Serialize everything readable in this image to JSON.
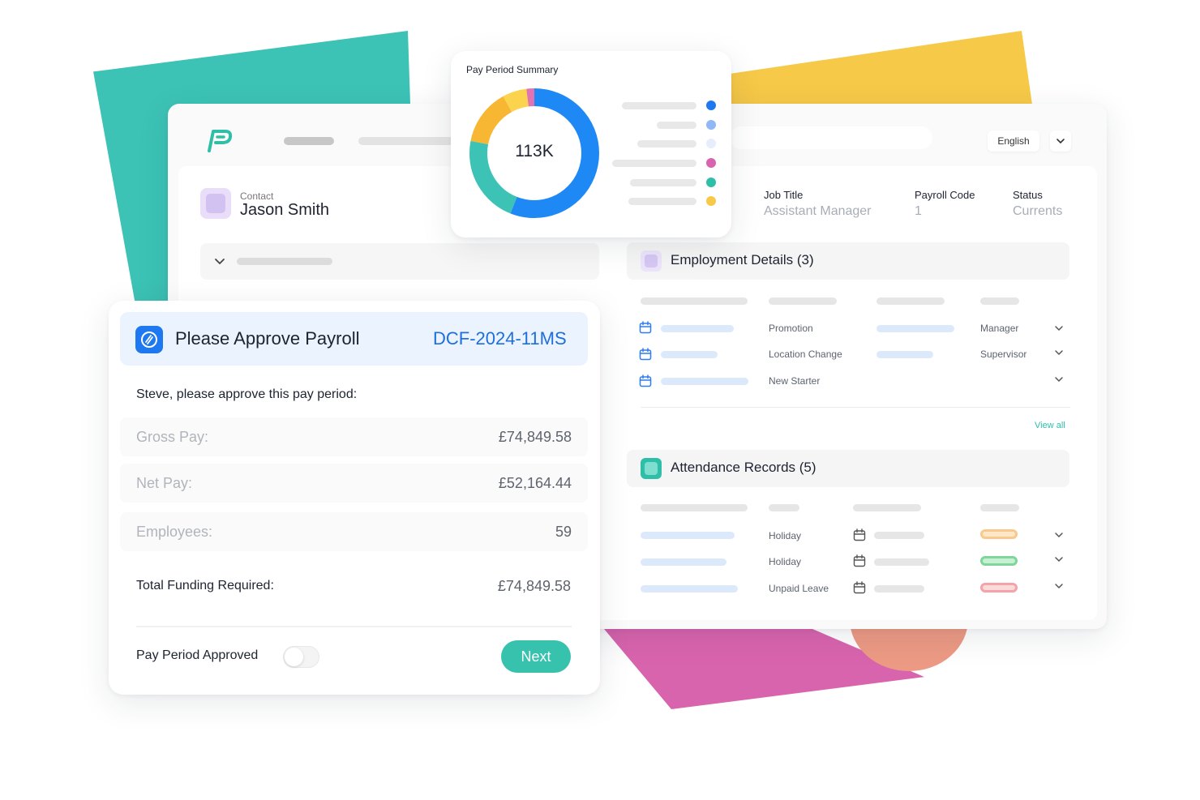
{
  "colors": {
    "accent_teal": "#36c2ad",
    "accent_blue": "#1e78f0",
    "approve_code": "#1e6fd9",
    "shape_teal": "#3cc3b6",
    "shape_yellow": "#f7c948",
    "shape_pink": "#d964ae",
    "shape_coral": "#ec9a84"
  },
  "header": {
    "language": "English",
    "logo_icon": "payroll-p-logo"
  },
  "contact": {
    "label": "Contact",
    "name": "Jason Smith"
  },
  "fields": [
    {
      "label": "Job Title",
      "value": "Assistant Manager"
    },
    {
      "label": "Payroll Code",
      "value": "1"
    },
    {
      "label": "Status",
      "value": "Currents"
    }
  ],
  "employment": {
    "title": "Employment Details (3)",
    "rows": [
      {
        "type": "Promotion",
        "role": "Manager"
      },
      {
        "type": "Location Change",
        "role": "Supervisor"
      },
      {
        "type": "New Starter",
        "role": ""
      }
    ],
    "view_all": "View all"
  },
  "attendance": {
    "title": "Attendance Records (5)",
    "rows": [
      {
        "type": "Holiday",
        "status_color": "#f9c98c"
      },
      {
        "type": "Holiday",
        "status_color": "#7fd69b"
      },
      {
        "type": "Unpaid Leave",
        "status_color": "#f4a3a8"
      }
    ]
  },
  "summary": {
    "title": "Pay Period Summary",
    "center_value": "113K",
    "legend_colors": [
      "#1e78f0",
      "#8fb8f5",
      "#e6eefb",
      "#d964ae",
      "#2fbfa8",
      "#f7c948"
    ]
  },
  "chart_data": {
    "type": "pie",
    "title": "Pay Period Summary",
    "values": [
      56,
      22,
      14,
      6,
      2
    ],
    "colors": [
      "#1e88f5",
      "#3cc3b6",
      "#f7b733",
      "#fcd34d",
      "#e173b2"
    ]
  },
  "approval": {
    "title": "Please Approve Payroll",
    "code": "DCF-2024-11MS",
    "subtitle": "Steve, please approve this pay period:",
    "rows": [
      {
        "label": "Gross Pay:",
        "value": "£74,849.58"
      },
      {
        "label": "Net Pay:",
        "value": "£52,164.44"
      },
      {
        "label": "Employees:",
        "value": "59"
      }
    ],
    "total_label": "Total Funding Required:",
    "total_value": "£74,849.58",
    "approved_label": "Pay Period Approved",
    "approved": false,
    "next_label": "Next"
  }
}
